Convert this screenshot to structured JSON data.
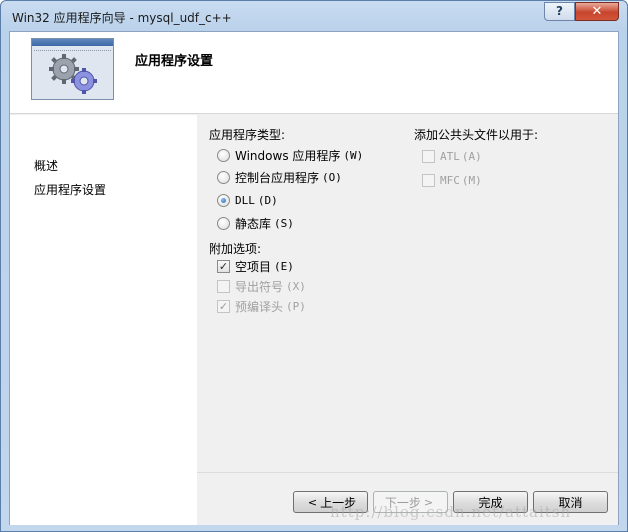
{
  "window": {
    "title": "Win32 应用程序向导 - mysql_udf_c++",
    "help_label": "?",
    "close_label": "✕"
  },
  "header": {
    "title": "应用程序设置"
  },
  "nav": {
    "items": [
      {
        "label": "概述"
      },
      {
        "label": "应用程序设置"
      }
    ]
  },
  "app_type": {
    "heading": "应用程序类型:",
    "options": [
      {
        "label": "Windows 应用程序",
        "accel": "(W)",
        "checked": false
      },
      {
        "label": "控制台应用程序",
        "accel": "(O)",
        "checked": false
      },
      {
        "label": "DLL",
        "accel": "(D)",
        "checked": true
      },
      {
        "label": "静态库",
        "accel": "(S)",
        "checked": false
      }
    ]
  },
  "extra": {
    "heading": "附加选项:",
    "options": [
      {
        "label": "空项目",
        "accel": "(E)",
        "checked": true,
        "enabled": true
      },
      {
        "label": "导出符号",
        "accel": "(X)",
        "checked": false,
        "enabled": false
      },
      {
        "label": "预编译头",
        "accel": "(P)",
        "checked": true,
        "enabled": false
      }
    ]
  },
  "common_headers": {
    "heading": "添加公共头文件以用于:",
    "options": [
      {
        "label": "ATL",
        "accel": "(A)",
        "checked": false,
        "enabled": false
      },
      {
        "label": "MFC",
        "accel": "(M)",
        "checked": false,
        "enabled": false
      }
    ]
  },
  "buttons": {
    "prev": "上一步",
    "next": "下一步",
    "finish": "完成",
    "cancel": "取消",
    "prev_arrow": "<",
    "next_arrow": ">"
  },
  "watermark": "http://blog.csdn.net/attaitsh"
}
